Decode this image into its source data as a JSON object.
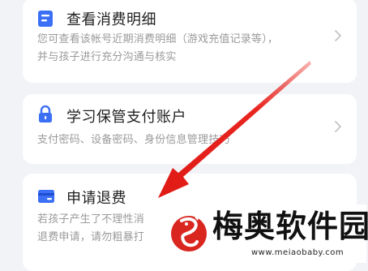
{
  "cards": [
    {
      "icon": "document-list-icon",
      "title": "查看消费明细",
      "desc_lines": [
        "您可查看该帐号近期消费明细（游戏充值记录等），",
        "并与孩子进行充分沟通与核实"
      ]
    },
    {
      "icon": "lock-icon",
      "title": "学习保管支付账户",
      "desc_lines": [
        "支付密码、设备密码、身份信息管理技巧"
      ]
    },
    {
      "icon": "wallet-card-icon",
      "title": "申请退费",
      "desc_lines": [
        "若孩子产生了不理性消",
        "退费申请，请勿粗暴打"
      ]
    }
  ],
  "watermark": {
    "name": "梅奥软件园",
    "url": "www.meiaobaby.com"
  },
  "colors": {
    "accent_blue": "#3b6ff5",
    "arrow_red": "#e8251f",
    "background": "#f1f3f6",
    "card": "#ffffff"
  }
}
